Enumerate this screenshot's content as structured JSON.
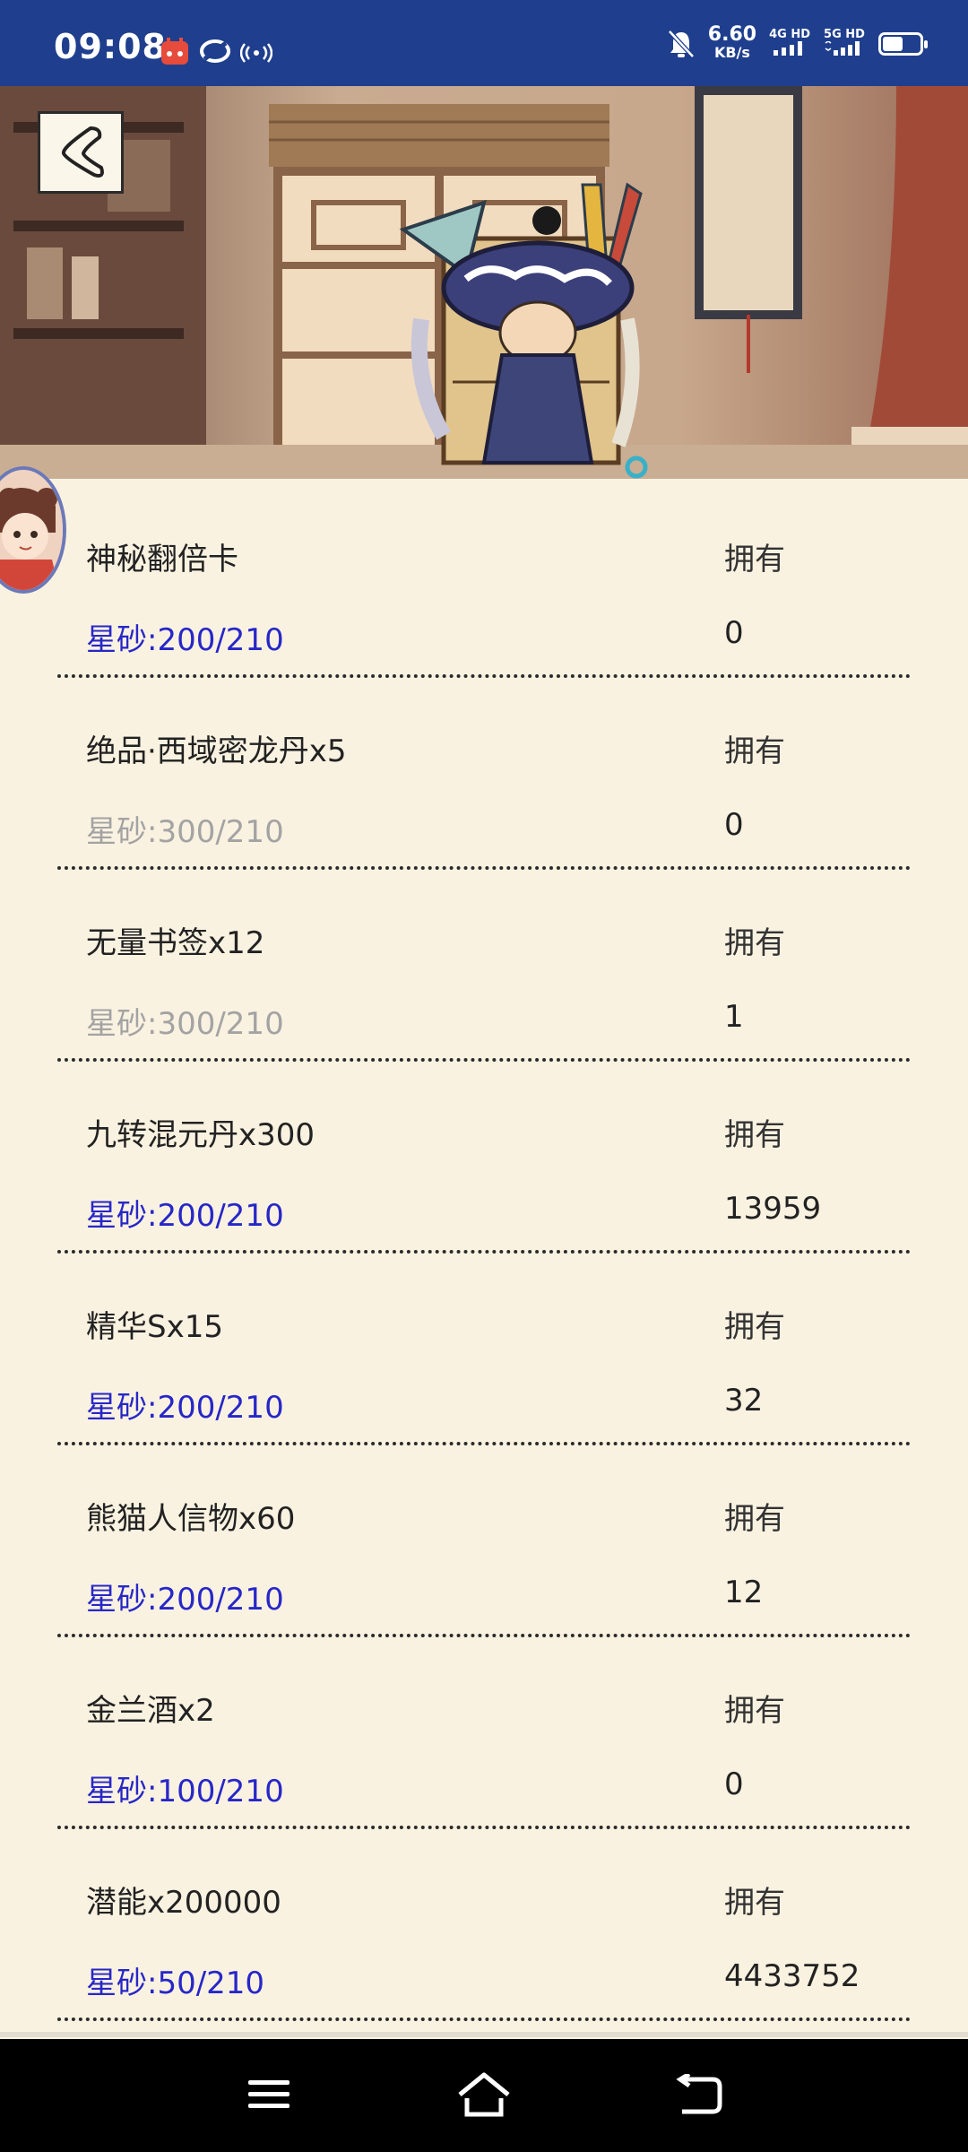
{
  "status_bar": {
    "time": "09:08",
    "speed_value": "6.60",
    "speed_unit": "KB/s",
    "net1": "4G HD",
    "net2": "5G HD",
    "battery_level": 0.55
  },
  "header": {
    "back_icon": "back-arrow-icon"
  },
  "owned_label": "拥有",
  "items": [
    {
      "name": "神秘翻倍卡",
      "price": "星砂:200/210",
      "affordable": true,
      "owned": "0"
    },
    {
      "name": "绝品·西域密龙丹x5",
      "price": "星砂:300/210",
      "affordable": false,
      "owned": "0"
    },
    {
      "name": "无量书签x12",
      "price": "星砂:300/210",
      "affordable": false,
      "owned": "1"
    },
    {
      "name": "九转混元丹x300",
      "price": "星砂:200/210",
      "affordable": true,
      "owned": "13959"
    },
    {
      "name": "精华Sx15",
      "price": "星砂:200/210",
      "affordable": true,
      "owned": "32"
    },
    {
      "name": "熊猫人信物x60",
      "price": "星砂:200/210",
      "affordable": true,
      "owned": "12"
    },
    {
      "name": "金兰酒x2",
      "price": "星砂:100/210",
      "affordable": true,
      "owned": "0"
    },
    {
      "name": "潜能x200000",
      "price": "星砂:50/210",
      "affordable": true,
      "owned": "4433752"
    }
  ],
  "colors": {
    "status_bar": "#1f3f8e",
    "page_bg": "#faf2e1",
    "price_affordable": "#2727c8",
    "price_unaffordable": "#a3a3a3"
  }
}
